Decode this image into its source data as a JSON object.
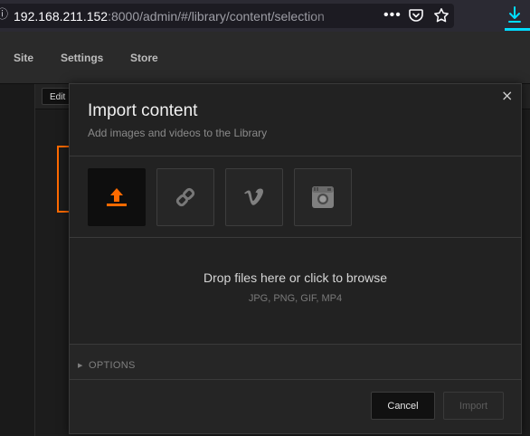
{
  "browser": {
    "url_host": "192.168.211.152",
    "url_rest": ":8000/admin/#/library/content/selection",
    "menu_dots": "•••"
  },
  "nav": {
    "items": [
      {
        "label": "Site"
      },
      {
        "label": "Settings"
      },
      {
        "label": "Store"
      }
    ]
  },
  "toolbar": {
    "edit_label": "Edit"
  },
  "modal": {
    "title": "Import content",
    "subtitle": "Add images and videos to the Library",
    "close_glyph": "×",
    "sources": [
      {
        "icon": "upload-icon",
        "active": true
      },
      {
        "icon": "link-icon",
        "active": false
      },
      {
        "icon": "vimeo-icon",
        "active": false
      },
      {
        "icon": "instagram-icon",
        "active": false
      }
    ],
    "dropzone": {
      "main": "Drop files here or click to browse",
      "formats": "JPG, PNG, GIF, MP4"
    },
    "options": {
      "arrow": "▶",
      "label": "OPTIONS"
    },
    "buttons": {
      "cancel": "Cancel",
      "import": "Import"
    }
  },
  "colors": {
    "accent": "#ff6a00",
    "browser_accent": "#00ddff"
  }
}
